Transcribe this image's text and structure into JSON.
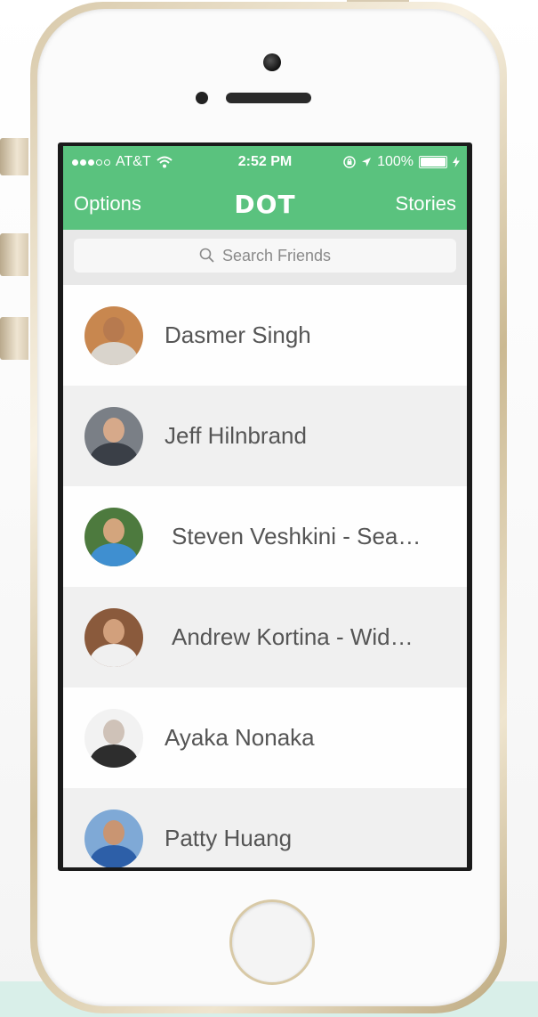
{
  "status_bar": {
    "carrier": "AT&T",
    "time": "2:52 PM",
    "battery_percent": "100%",
    "battery_level": 1.0,
    "signal_bars_filled": 3,
    "signal_bars_total": 5
  },
  "nav": {
    "left_label": "Options",
    "logo": "DOT",
    "right_label": "Stories"
  },
  "search": {
    "placeholder": "Search Friends"
  },
  "friends": [
    {
      "name": "Dasmer Singh"
    },
    {
      "name": "Jeff Hilnbrand"
    },
    {
      "name": "Steven Veshkini - Sea…"
    },
    {
      "name": "Andrew Kortina - Wid…"
    },
    {
      "name": "Ayaka Nonaka"
    },
    {
      "name": "Patty Huang"
    }
  ],
  "colors": {
    "accent": "#5ac27e",
    "text": "#555555",
    "phone_gold": "#d8c9aa"
  }
}
